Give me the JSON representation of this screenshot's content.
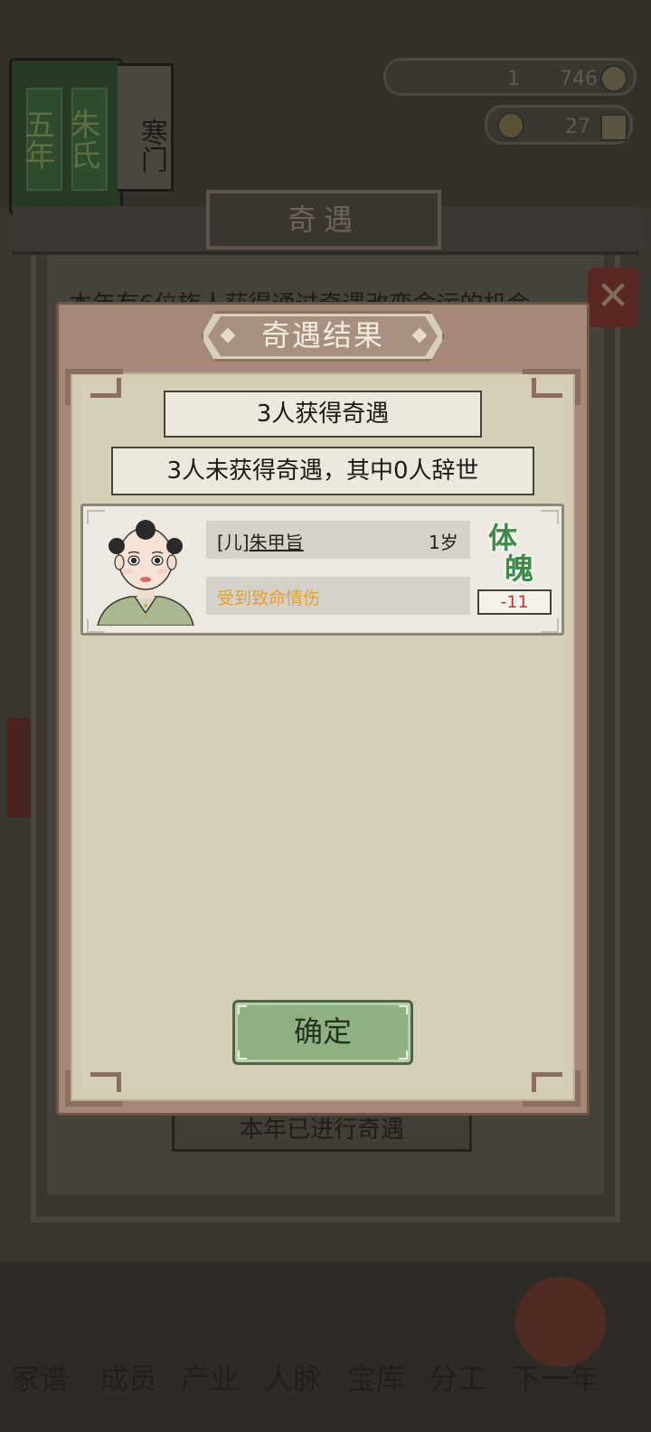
{
  "background": {
    "book_tag_left": "五年",
    "book_tag_right": "朱氏",
    "book_side_label": "寒门",
    "resource1_value": "1",
    "resource2_value": "746",
    "resource3_value": "27",
    "outer_title": "奇遇",
    "outer_text": "本年有6位族人获得通过奇遇改变命运的机会",
    "done_label": "本年已进行奇遇",
    "nav": [
      "家谱",
      "成员",
      "产业",
      "人脉",
      "宝库",
      "分工",
      "下一年"
    ]
  },
  "modal": {
    "title": "奇遇结果",
    "summary_got": "3人获得奇遇",
    "summary_not_got": "3人未获得奇遇，其中0人辞世",
    "members": [
      {
        "relation": "[儿]",
        "name": "朱甲旨",
        "age": "1岁",
        "event": "受到致命情伤",
        "stat_name": "体魄",
        "stat_change": "-11"
      }
    ],
    "confirm_label": "确定"
  },
  "colors": {
    "accent_green": "#3f8a4b",
    "event_orange": "#e5a02a",
    "negative_red": "#c2372f",
    "frame_brown": "#a6887a"
  }
}
